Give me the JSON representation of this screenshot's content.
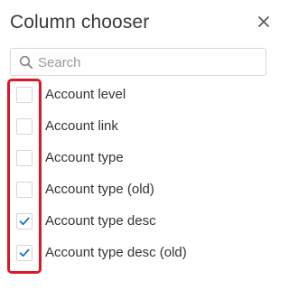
{
  "dialog": {
    "title": "Column chooser",
    "close_icon": "close-icon"
  },
  "search": {
    "placeholder": "Search",
    "value": "",
    "icon": "search-icon"
  },
  "columns": [
    {
      "label": "Account level",
      "checked": false
    },
    {
      "label": "Account link",
      "checked": false
    },
    {
      "label": "Account type",
      "checked": false
    },
    {
      "label": "Account type (old)",
      "checked": false
    },
    {
      "label": "Account type desc",
      "checked": true
    },
    {
      "label": "Account type desc (old)",
      "checked": true
    }
  ],
  "colors": {
    "check": "#1a73c8",
    "highlight": "#d9182a"
  }
}
